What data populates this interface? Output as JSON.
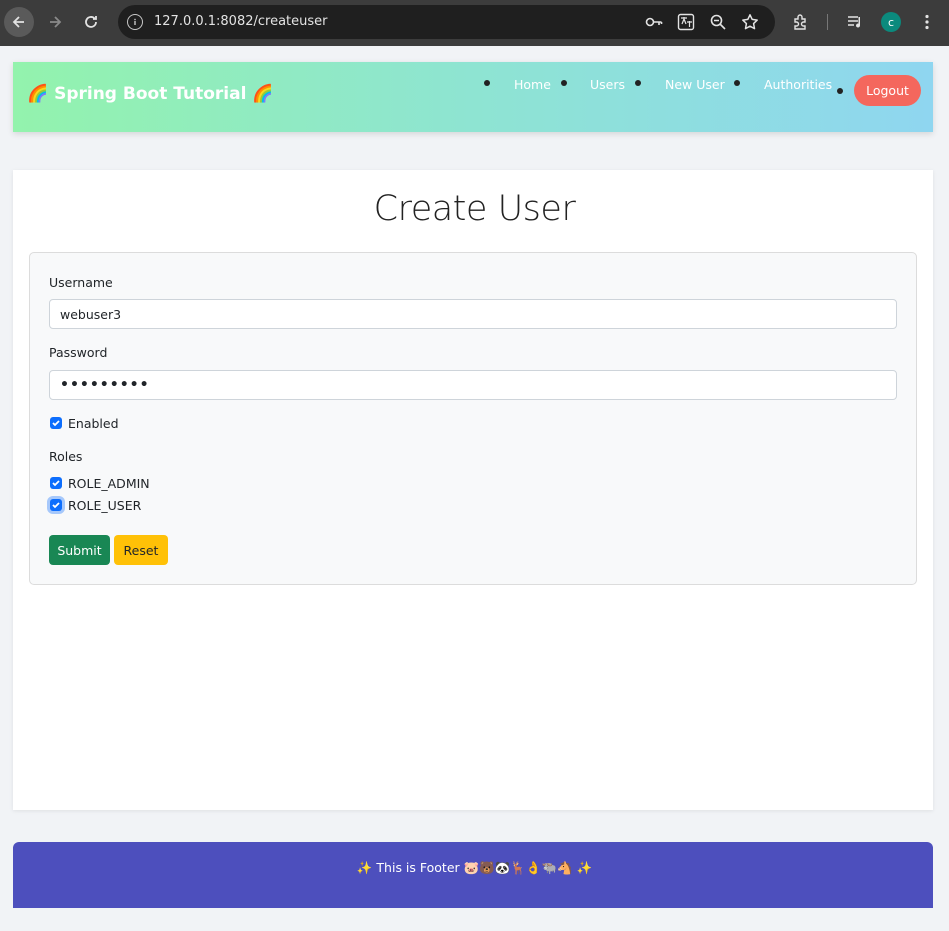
{
  "browser": {
    "url": "127.0.0.1:8082/createuser",
    "profile_initial": "c"
  },
  "header": {
    "brand": "🌈 Spring Boot Tutorial 🌈",
    "nav": {
      "home": "Home",
      "users": "Users",
      "new_user": "New User",
      "authorities": "Authorities"
    },
    "logout": "Logout"
  },
  "page": {
    "title": "Create User"
  },
  "form": {
    "username_label": "Username",
    "username_value": "webuser3",
    "password_label": "Password",
    "password_value": "•••••••••",
    "enabled_label": "Enabled",
    "enabled_checked": true,
    "roles_label": "Roles",
    "roles": [
      {
        "label": "ROLE_ADMIN",
        "checked": true
      },
      {
        "label": "ROLE_USER",
        "checked": true
      }
    ],
    "submit_label": "Submit",
    "reset_label": "Reset"
  },
  "footer": {
    "text": "✨ This is Footer 🐷🐻🐼🦌👌🐃🐴 ✨"
  },
  "colors": {
    "primary": "#0d6efd",
    "submit": "#198754",
    "reset": "#ffc107",
    "logout": "#f4675d",
    "footer": "#4d4fbd"
  }
}
